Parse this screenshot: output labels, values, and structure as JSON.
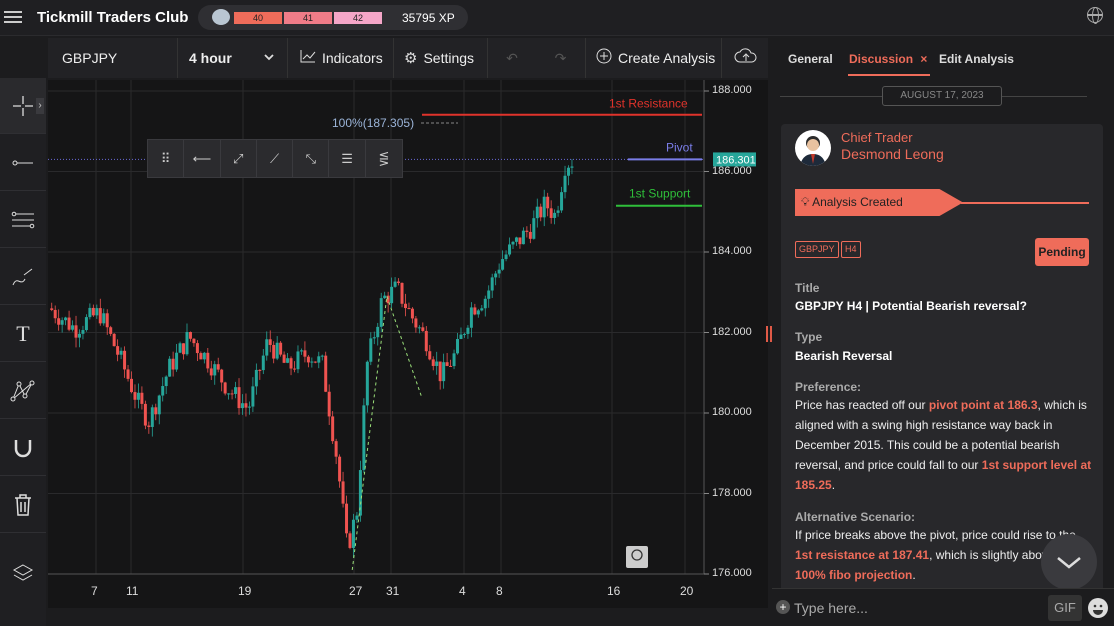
{
  "app": {
    "title": "Tickmill Traders Club"
  },
  "xp": {
    "segments": [
      "40",
      "41",
      "42"
    ],
    "total": "35795 XP"
  },
  "toolbar": {
    "symbol": "GBPJPY",
    "timeframe": "4 hour",
    "indicators_label": "Indicators",
    "settings_label": "Settings",
    "create_analysis_label": "Create Analysis"
  },
  "chart_data": {
    "type": "candlestick",
    "symbol": "GBPJPY",
    "timeframe": "4 hour",
    "ylim": [
      176.0,
      188.0
    ],
    "y_ticks": [
      "188.000",
      "186.000",
      "184.000",
      "182.000",
      "180.000",
      "178.000",
      "176.000"
    ],
    "x_ticks": [
      "7",
      "11",
      "19",
      "27",
      "31",
      "4",
      "8",
      "16",
      "20"
    ],
    "current_price": "186.301",
    "levels": [
      {
        "label": "1st Resistance",
        "value": 187.41,
        "color": "#e0332b"
      },
      {
        "label": "Pivot",
        "value": 186.3,
        "color": "#7a7de8"
      },
      {
        "label": "1st Support",
        "value": 185.15,
        "color": "#2fbf3a"
      }
    ],
    "fibo_label": "100%(187.305)",
    "fibo_value": 187.305,
    "price_path": [
      [
        0,
        182.6
      ],
      [
        5,
        182.1
      ],
      [
        10,
        182.5
      ],
      [
        14,
        181.4
      ],
      [
        18,
        180.2
      ],
      [
        20,
        179.8
      ],
      [
        24,
        181.1
      ],
      [
        28,
        181.9
      ],
      [
        32,
        181.3
      ],
      [
        36,
        180.6
      ],
      [
        40,
        180.1
      ],
      [
        44,
        181.8
      ],
      [
        48,
        181.1
      ],
      [
        52,
        181.5
      ],
      [
        55,
        181.2
      ],
      [
        58,
        178.8
      ],
      [
        60,
        176.6
      ],
      [
        62,
        177.6
      ],
      [
        64,
        181.2
      ],
      [
        67,
        182.8
      ],
      [
        70,
        183.1
      ],
      [
        73,
        182.4
      ],
      [
        76,
        181.8
      ],
      [
        79,
        180.9
      ],
      [
        82,
        181.5
      ],
      [
        85,
        182.6
      ],
      [
        88,
        182.9
      ],
      [
        91,
        183.8
      ],
      [
        94,
        184.2
      ],
      [
        97,
        184.6
      ],
      [
        100,
        185.2
      ],
      [
        102,
        184.9
      ],
      [
        104,
        186.2
      ],
      [
        106,
        186.3
      ]
    ],
    "fib_points": [
      [
        61,
        176.1
      ],
      [
        68,
        182.9
      ],
      [
        75,
        180.4
      ]
    ]
  },
  "panel": {
    "tabs": [
      "General",
      "Discussion",
      "Edit Analysis"
    ],
    "active_tab": "Discussion",
    "date": "AUGUST 17, 2023",
    "author_role": "Chief Trader",
    "author_name": "Desmond Leong",
    "banner": "Analysis Created",
    "tags": [
      "GBPJPY",
      "H4"
    ],
    "status": "Pending",
    "title_label": "Title",
    "title_value": "GBPJPY H4 | Potential Bearish reversal?",
    "type_label": "Type",
    "type_value": "Bearish Reversal",
    "preference_label": "Preference:",
    "preference": {
      "t1": "Price has reacted off our ",
      "h1": "pivot point at 186.3",
      "t2": ", which is aligned with a swing high resistance way back in December 2015. This could be a potential bearish reversal, and price could fall to our ",
      "h2": "1st support level at 185.25",
      "t3": "."
    },
    "alt_label": "Alternative Scenario:",
    "alt": {
      "t1": "If price breaks above the pivot, price could rise to the ",
      "h1": "1st resistance at 187.41",
      "t2": ", which is slightly above the ",
      "h2": "100% fibo projection",
      "t3": "."
    },
    "chat_placeholder": "Type here...",
    "gif_label": "GIF"
  }
}
